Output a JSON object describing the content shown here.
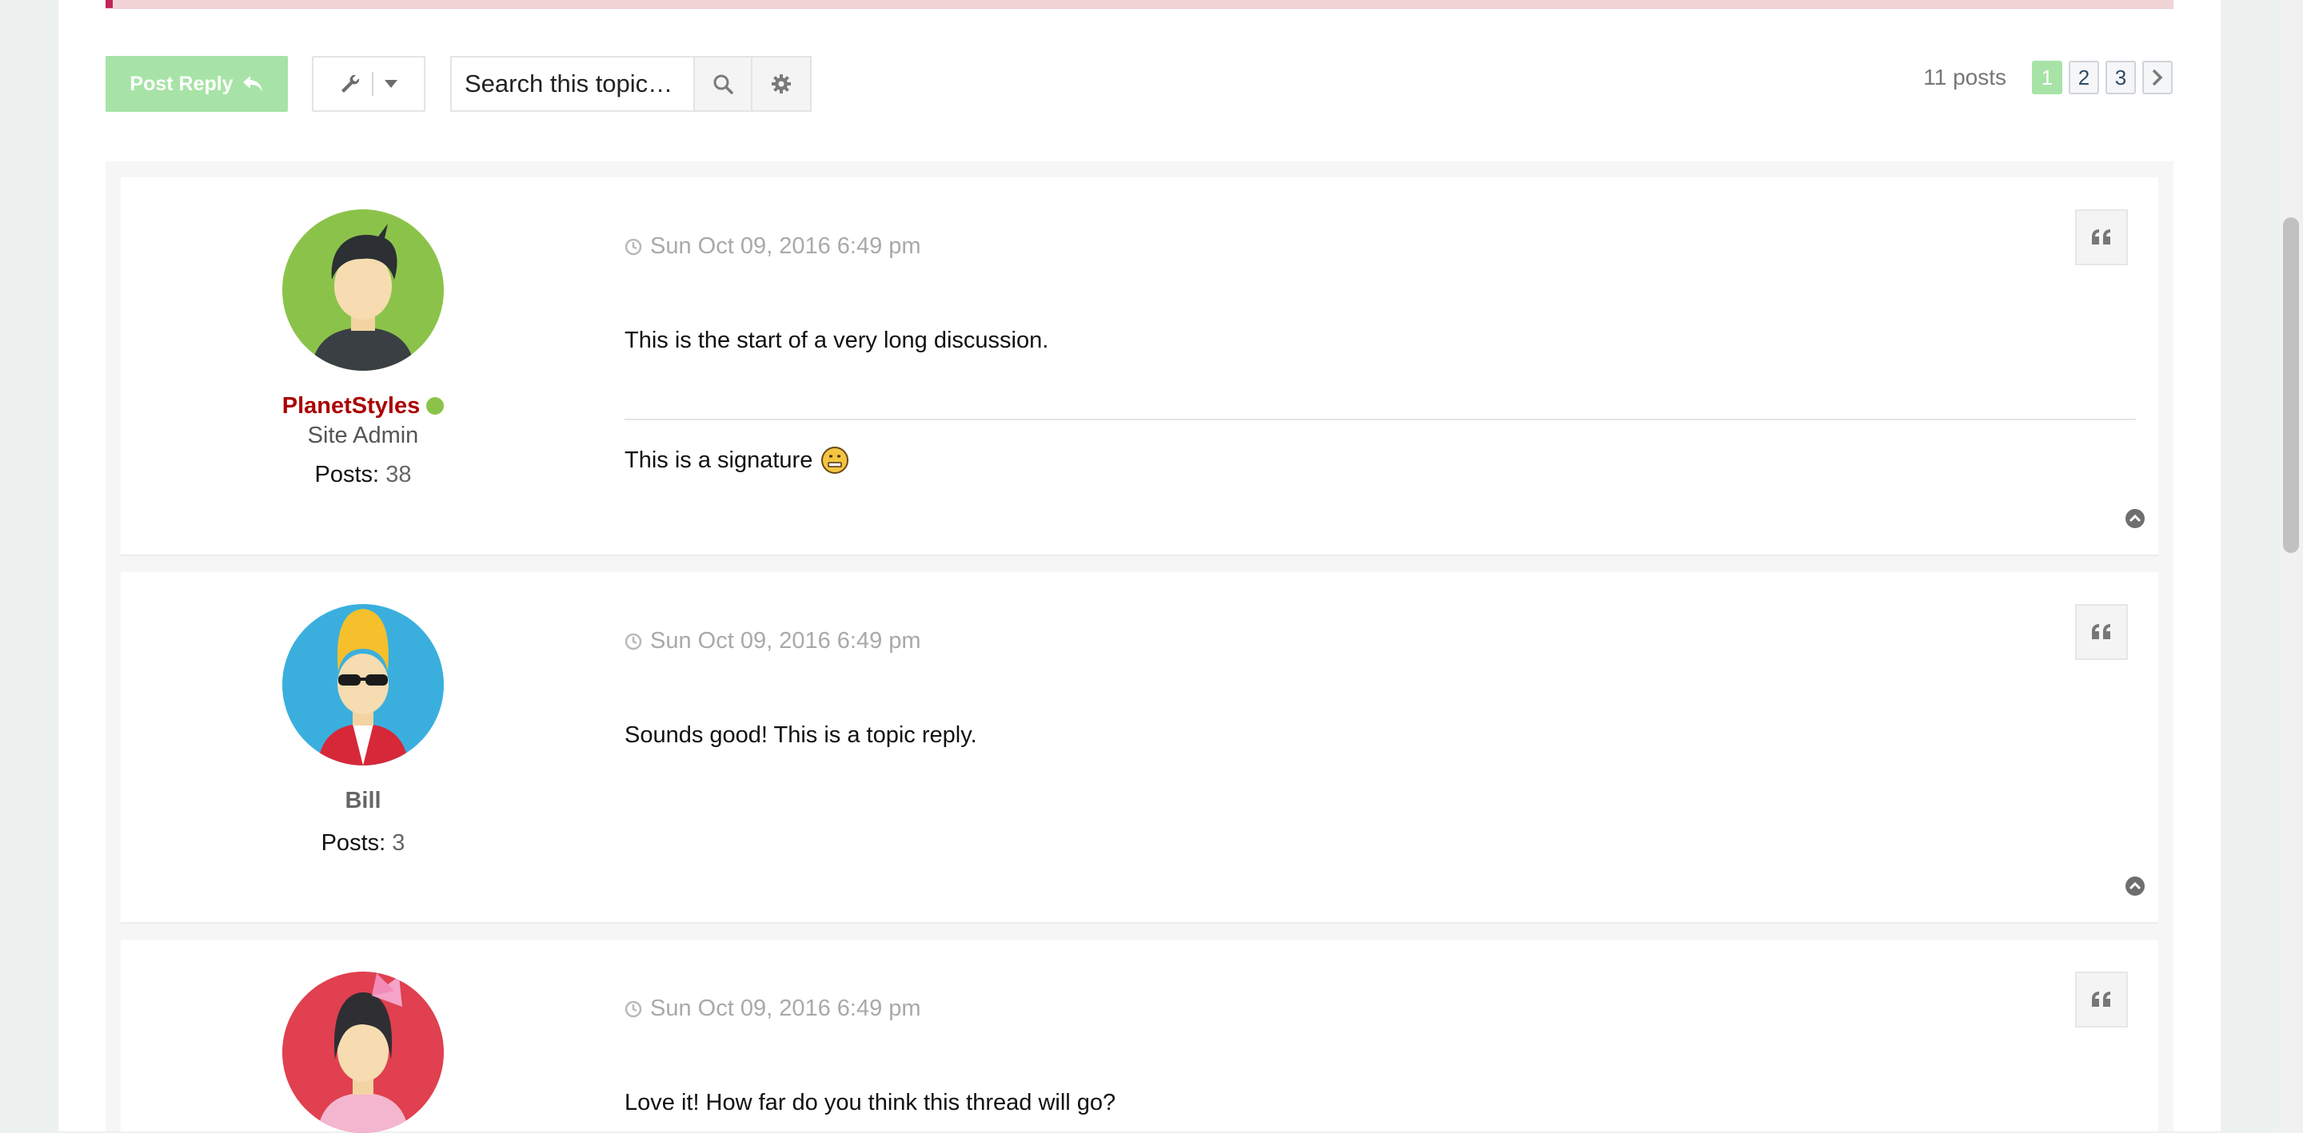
{
  "toolbar": {
    "post_reply_label": "Post Reply",
    "search_placeholder": "Search this topic…"
  },
  "pagination": {
    "post_count": "11 posts",
    "pages": [
      "1",
      "2",
      "3"
    ],
    "current": "1"
  },
  "posts": [
    {
      "username": "PlanetStyles",
      "rank": "Site Admin",
      "online": true,
      "posts_label": "Posts:",
      "posts_count": "38",
      "date": "Sun Oct 09, 2016 6:49 pm",
      "content": "This is the start of a very long discussion.",
      "signature": "This is a signature",
      "avatar_color": "#8bc34a"
    },
    {
      "username": "Bill",
      "rank": "",
      "online": false,
      "posts_label": "Posts:",
      "posts_count": "3",
      "date": "Sun Oct 09, 2016 6:49 pm",
      "content": "Sounds good! This is a topic reply.",
      "signature": "",
      "avatar_color": "#3aafde"
    },
    {
      "username": "",
      "rank": "",
      "online": false,
      "posts_label": "",
      "posts_count": "",
      "date": "Sun Oct 09, 2016 6:49 pm",
      "content": "Love it! How far do you think this thread will go?",
      "signature": "",
      "avatar_color": "#e0404f"
    }
  ],
  "colors": {
    "accent_green": "#a7e3a6",
    "admin_red": "#aa0000",
    "online_green": "#8bc34a"
  }
}
